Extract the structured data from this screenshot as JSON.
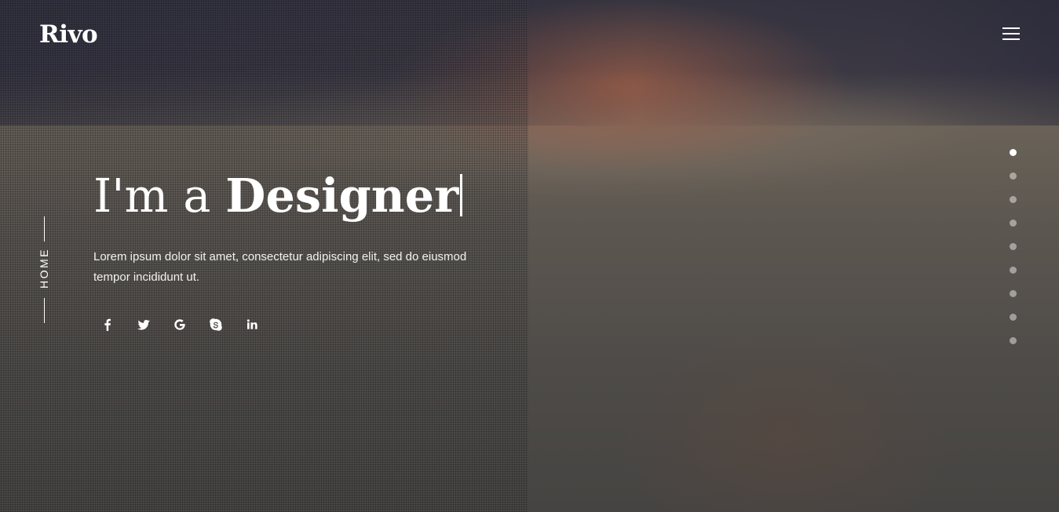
{
  "brand": {
    "logo_text": "Rivo"
  },
  "nav": {
    "menu_icon": "hamburger-menu-icon"
  },
  "section": {
    "label": "HOME"
  },
  "hero": {
    "headline_prefix": "I'm a ",
    "headline_word": "Designer",
    "description": "Lorem ipsum dolor sit amet, consectetur adipiscing elit, sed do eiusmod tempor incididunt ut."
  },
  "social": [
    {
      "name": "facebook",
      "icon": "facebook-icon"
    },
    {
      "name": "twitter",
      "icon": "twitter-icon"
    },
    {
      "name": "google",
      "icon": "google-icon"
    },
    {
      "name": "skype",
      "icon": "skype-icon"
    },
    {
      "name": "linkedin",
      "icon": "linkedin-icon"
    }
  ],
  "pagination": {
    "total": 9,
    "active_index": 0
  },
  "colors": {
    "text": "#ffffff",
    "dot_inactive": "rgba(255,255,255,0.45)"
  }
}
